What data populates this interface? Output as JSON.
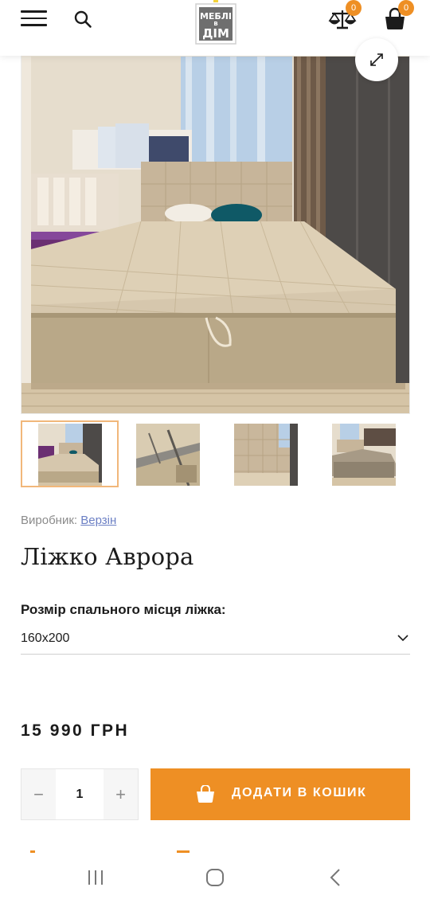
{
  "header": {
    "logo_lines": [
      "МЕБЛІ",
      "В",
      "ДІМ"
    ],
    "compare_count": "0",
    "cart_count": "0",
    "brand_color": "#ee8f24"
  },
  "icons": {
    "menu": "hamburger-icon",
    "search": "search-icon",
    "compare": "scales-icon",
    "cart": "shopping-bag-icon",
    "zoom": "expand-icon",
    "select": "chevron-down-icon",
    "nav_recent": "recent-apps-icon",
    "nav_home": "home-icon",
    "nav_back": "back-icon"
  },
  "gallery": {
    "main_alt": "Ліжко Аврора",
    "thumbnail_count": 4,
    "active_thumbnail": 1
  },
  "product": {
    "maker_label": "Виробник:",
    "maker_name": "Верзін",
    "title": "Ліжко Аврора",
    "size_label": "Розмір спального місця ліжка:",
    "size_value": "160х200",
    "price": "15 990 ГРН",
    "quantity": "1",
    "minus": "−",
    "plus": "+",
    "add_to_cart": "ДОДАТИ В КОШИК"
  }
}
